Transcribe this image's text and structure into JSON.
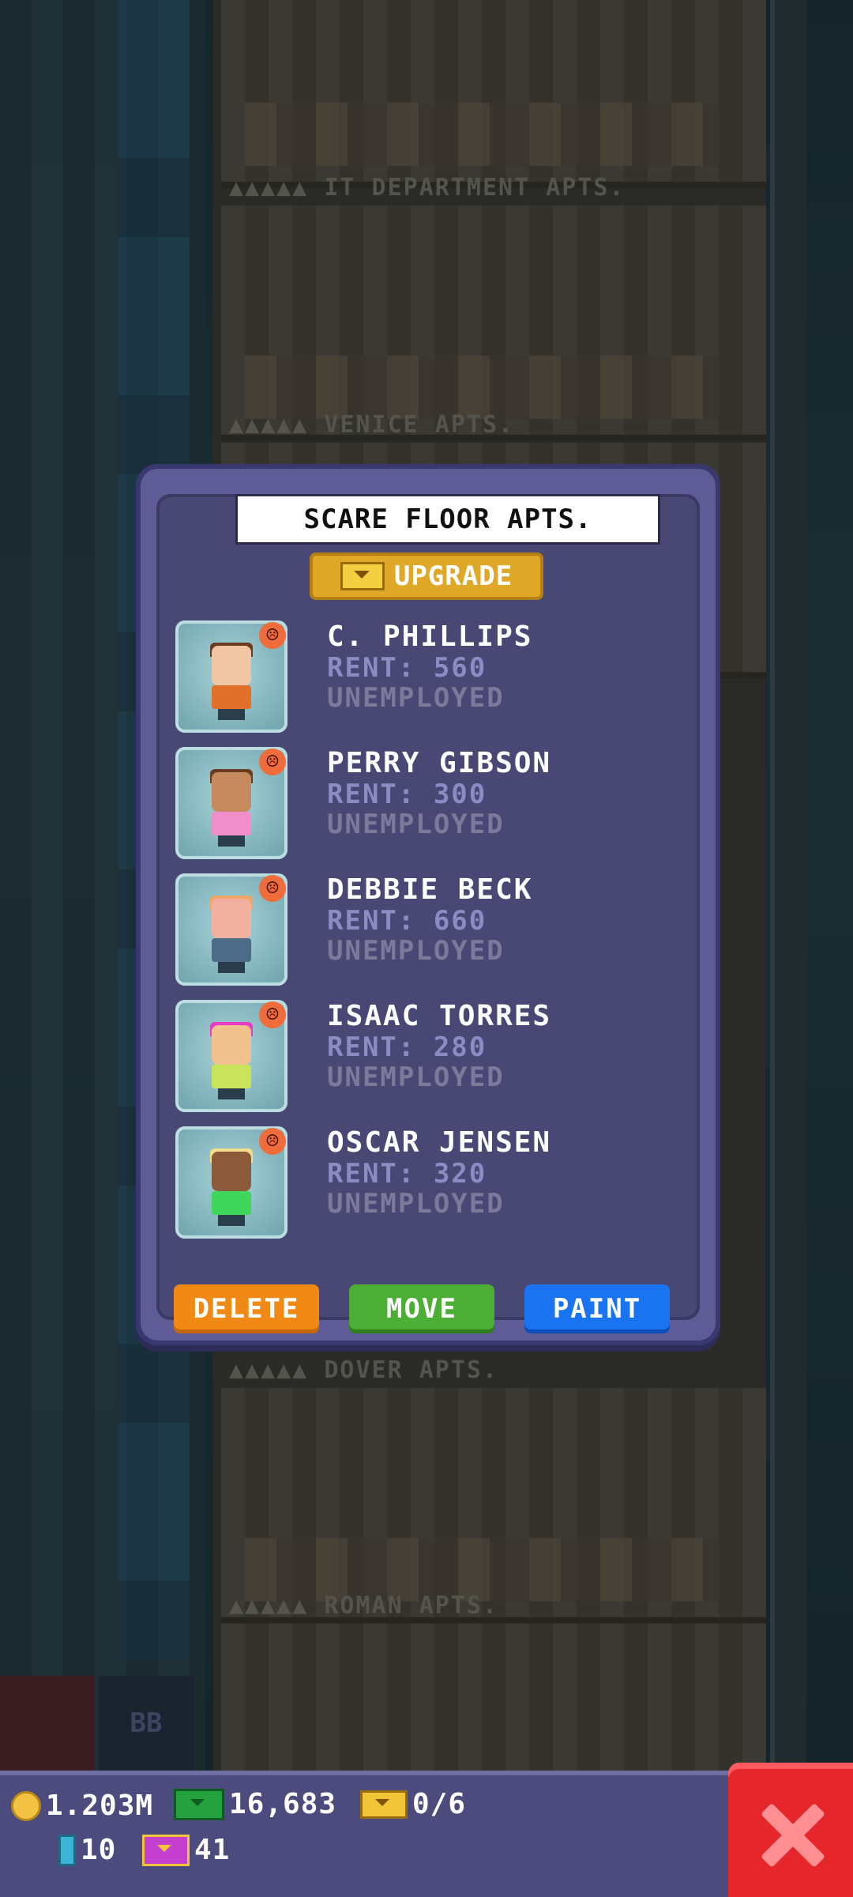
{
  "background_floors": [
    {
      "label": "▲▲▲▲▲ IT DEPARTMENT APTS."
    },
    {
      "label": "▲▲▲▲▲ VENICE APTS."
    },
    {
      "label": "▲▲▲▲▲ DOVER APTS."
    },
    {
      "label": "▲▲▲▲▲ ROMAN APTS."
    }
  ],
  "floor_button_label": "BB",
  "dialog": {
    "title": "SCARE FLOOR APTS.",
    "upgrade_label": "UPGRADE",
    "residents": [
      {
        "name": "C. PHILLIPS",
        "rent": "RENT: 560",
        "job": "UNEMPLOYED",
        "mood_icon": "sad-face-icon",
        "hair": "#6b3b22",
        "skin": "#f1c6a4",
        "shirt": "#e0702a"
      },
      {
        "name": "PERRY GIBSON",
        "rent": "RENT: 300",
        "job": "UNEMPLOYED",
        "mood_icon": "sad-face-icon",
        "hair": "#6b3b22",
        "skin": "#c58a5e",
        "shirt": "#f08ecb"
      },
      {
        "name": "DEBBIE BECK",
        "rent": "RENT: 660",
        "job": "UNEMPLOYED",
        "mood_icon": "sad-face-icon",
        "hair": "#f0a765",
        "skin": "#f2b0a0",
        "shirt": "#4b6b87"
      },
      {
        "name": "ISAAC TORRES",
        "rent": "RENT: 280",
        "job": "UNEMPLOYED",
        "mood_icon": "sad-face-icon",
        "hair": "#e83cc7",
        "skin": "#f1c28d",
        "shirt": "#c9e35a"
      },
      {
        "name": "OSCAR JENSEN",
        "rent": "RENT: 320",
        "job": "UNEMPLOYED",
        "mood_icon": "sad-face-icon",
        "hair": "#f2de8a",
        "skin": "#8a5a3b",
        "shirt": "#3fd65c"
      }
    ],
    "buttons": {
      "delete": "DELETE",
      "move": "MOVE",
      "paint": "PAINT"
    }
  },
  "status_bar": {
    "coins": "1.203M",
    "cash": "16,683",
    "golden_bux": "0/6",
    "tickets": "10",
    "vip": "41"
  }
}
